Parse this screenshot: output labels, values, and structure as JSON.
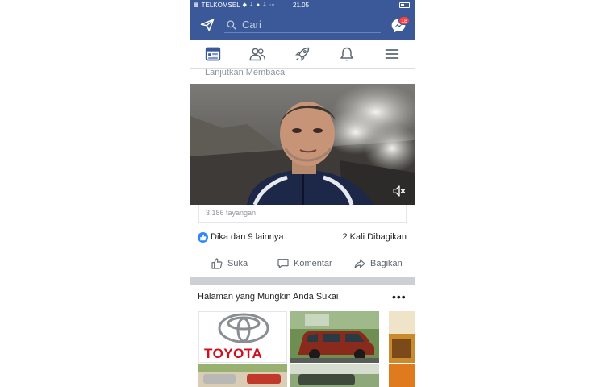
{
  "status_bar": {
    "carrier": "TELKOMSEL",
    "time": "21.05"
  },
  "header": {
    "search_placeholder": "Cari",
    "messenger_badge": "18"
  },
  "tabs": [
    {
      "icon": "news-feed-icon"
    },
    {
      "icon": "friends-icon"
    },
    {
      "icon": "rocket-icon"
    },
    {
      "icon": "bell-icon"
    },
    {
      "icon": "menu-icon"
    }
  ],
  "post": {
    "continue_reading": "Lanjutkan Membaca",
    "views": "3.186 tayangan",
    "reactions": "Dika dan 9 lainnya",
    "shares": "2 Kali Dibagikan",
    "actions": {
      "like": "Suka",
      "comment": "Komentar",
      "share": "Bagikan"
    }
  },
  "suggested_pages": {
    "title": "Halaman yang Mungkin Anda Sukai",
    "cards": [
      {
        "logo_text": "TOYOTA"
      }
    ]
  },
  "colors": {
    "facebook_blue": "#3b5998",
    "badge_red": "#fa3e3e",
    "toyota_red": "#d20f1e",
    "like_blue": "#2d88ff"
  }
}
